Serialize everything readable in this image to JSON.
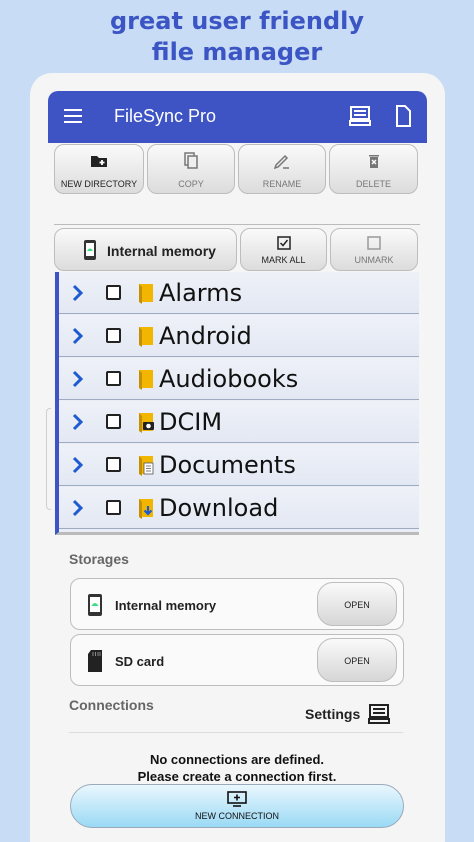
{
  "promo": {
    "line1": "great user friendly",
    "line2": "file manager"
  },
  "appbar": {
    "title": "FileSync Pro",
    "menu_icon": "hamburger-menu-icon",
    "pc_icon": "computer-icon",
    "doc_icon": "document-icon"
  },
  "toolbar": {
    "new_directory": "NEW DIRECTORY",
    "copy": "COPY",
    "rename": "RENAME",
    "delete": "DELETE"
  },
  "selection": {
    "storage": "Internal memory",
    "mark_all": "MARK ALL",
    "unmark": "UNMARK"
  },
  "files": [
    {
      "name": "Alarms",
      "icon": "folder-icon"
    },
    {
      "name": "Android",
      "icon": "folder-icon"
    },
    {
      "name": "Audiobooks",
      "icon": "folder-icon"
    },
    {
      "name": "DCIM",
      "icon": "camera-folder-icon"
    },
    {
      "name": "Documents",
      "icon": "documents-folder-icon"
    },
    {
      "name": "Download",
      "icon": "download-folder-icon"
    }
  ],
  "storages": {
    "heading": "Storages",
    "items": [
      {
        "name": "Internal memory",
        "button": "OPEN",
        "icon": "phone-icon"
      },
      {
        "name": "SD card",
        "button": "OPEN",
        "icon": "sd-card-icon"
      }
    ]
  },
  "connections": {
    "heading": "Connections",
    "settings": "Settings",
    "empty_line1": "No connections are defined.",
    "empty_line2": "Please create a connection first.",
    "new_connection": "NEW CONNECTION"
  },
  "colors": {
    "accent": "#3e54c4",
    "promo_text": "#3b55c4",
    "background": "#c9dcf5",
    "folder": "#f2b600"
  }
}
